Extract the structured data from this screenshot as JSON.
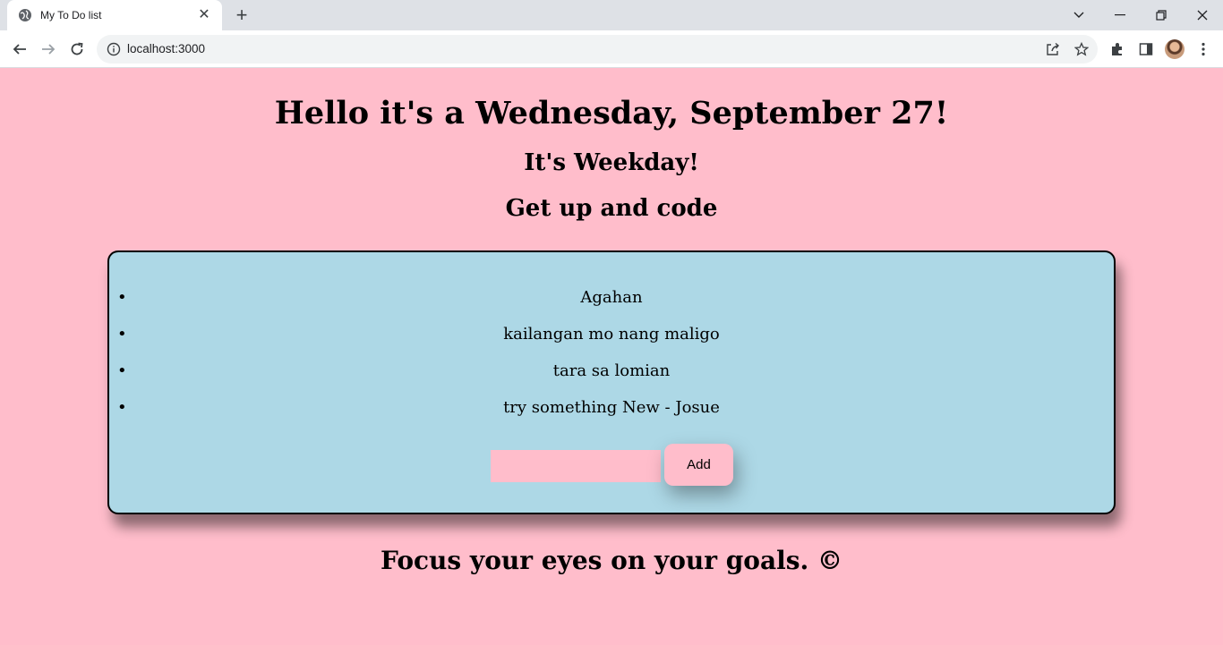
{
  "browser": {
    "tab": {
      "title": "My To Do list",
      "close_glyph": "✕",
      "favicon": "globe-icon"
    },
    "new_tab_glyph": "+",
    "url": "localhost:3000",
    "window_controls": {
      "tabsearch": "⌄",
      "minimize": "—",
      "restore": "❐",
      "close": "✕"
    }
  },
  "page": {
    "greeting": "Hello it's a Wednesday, September 27!",
    "day_type": "It's Weekday!",
    "motto": "Get up and code",
    "items": [
      {
        "bullet": "•",
        "text": "Agahan"
      },
      {
        "bullet": "•",
        "text": "kailangan mo nang maligo"
      },
      {
        "bullet": "•",
        "text": "tara sa lomian"
      },
      {
        "bullet": "•",
        "text": "try something New - Josue"
      }
    ],
    "new_item_value": "",
    "add_label": "Add",
    "footer": "Focus your eyes on your goals. ©"
  },
  "colors": {
    "page_bg": "#ffbdcb",
    "card_bg": "#add8e6"
  }
}
